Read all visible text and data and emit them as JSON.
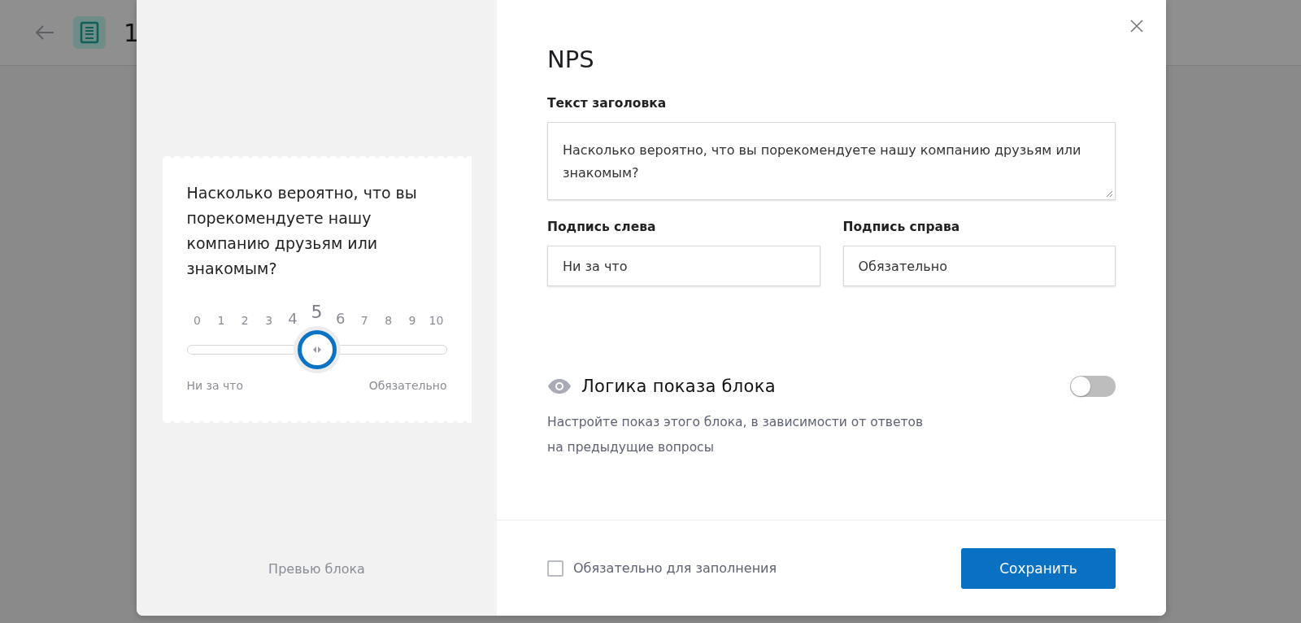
{
  "background": {
    "page_title": "1"
  },
  "preview": {
    "question": "Насколько вероятно, что вы порекомендуете нашу компанию друзьям или знакомым?",
    "scale": [
      {
        "label": "0",
        "selected": false
      },
      {
        "label": "1",
        "selected": false
      },
      {
        "label": "2",
        "selected": false
      },
      {
        "label": "3",
        "selected": false
      },
      {
        "label": "4",
        "selected": false
      },
      {
        "label": "5",
        "selected": true
      },
      {
        "label": "6",
        "selected": false
      },
      {
        "label": "7",
        "selected": false
      },
      {
        "label": "8",
        "selected": false
      },
      {
        "label": "9",
        "selected": false
      },
      {
        "label": "10",
        "selected": false
      }
    ],
    "level": 0.5,
    "left_label": "Ни за что",
    "right_label": "Обязательно",
    "caption": "Превью блока"
  },
  "editor": {
    "title": "NPS",
    "heading_label": "Текст заголовка",
    "heading_value": "Насколько вероятно, что вы порекомендуете нашу компанию друзьям или знакомым?",
    "left_caption_label": "Подпись слева",
    "left_caption_value": "Ни за что",
    "right_caption_label": "Подпись справа",
    "right_caption_value": "Обязательно",
    "logic": {
      "title": "Логика показа блока",
      "on": false,
      "description": "Настройте показ этого блока, в зависимости от ответов на предыдущие вопросы"
    },
    "required": {
      "label": "Обязательно для заполнения",
      "checked": false
    },
    "save_button": "Сохранить"
  }
}
